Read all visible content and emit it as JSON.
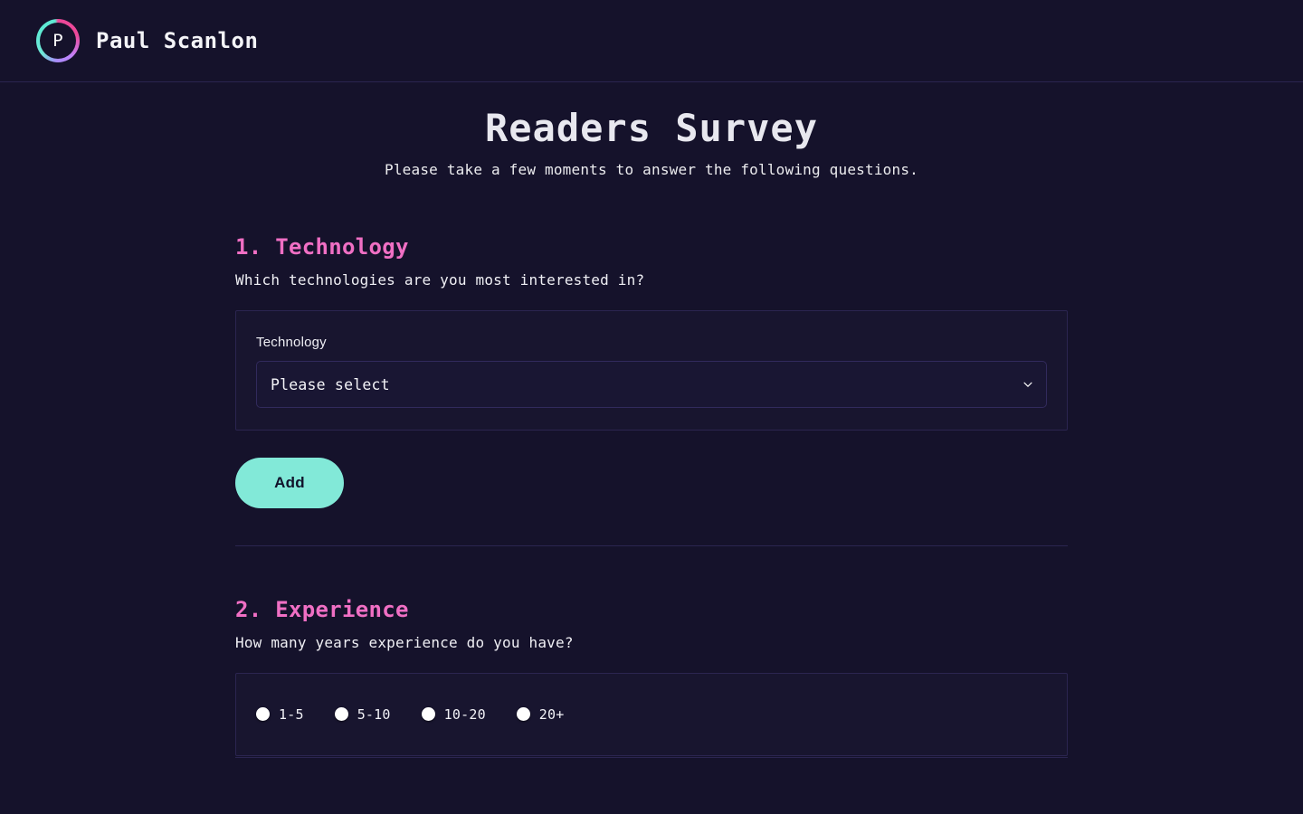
{
  "header": {
    "logo_letter": "P",
    "brand_name": "Paul Scanlon",
    "logo_colors": {
      "teal": "#5eead4",
      "pink": "#ec4899",
      "purple": "#a78bfa"
    }
  },
  "page": {
    "title": "Readers Survey",
    "subtitle": "Please take a few moments to answer the following questions."
  },
  "questions": [
    {
      "number": "1.",
      "label": "Technology",
      "prompt": "Which technologies are you most interested in?",
      "field_label": "Technology",
      "select_value": "Please select",
      "select_placeholder": "Please select",
      "add_button": "Add"
    },
    {
      "number": "2.",
      "label": "Experience",
      "prompt": "How many years experience do you have?",
      "options": [
        {
          "label": "1-5"
        },
        {
          "label": "5-10"
        },
        {
          "label": "10-20"
        },
        {
          "label": "20+"
        }
      ]
    }
  ],
  "colors": {
    "background": "#15122b",
    "panel": "#18152f",
    "border": "#2b2550",
    "heading_accent": "#f06fc4",
    "button": "#82e9d8",
    "text": "#f2f2f7"
  }
}
